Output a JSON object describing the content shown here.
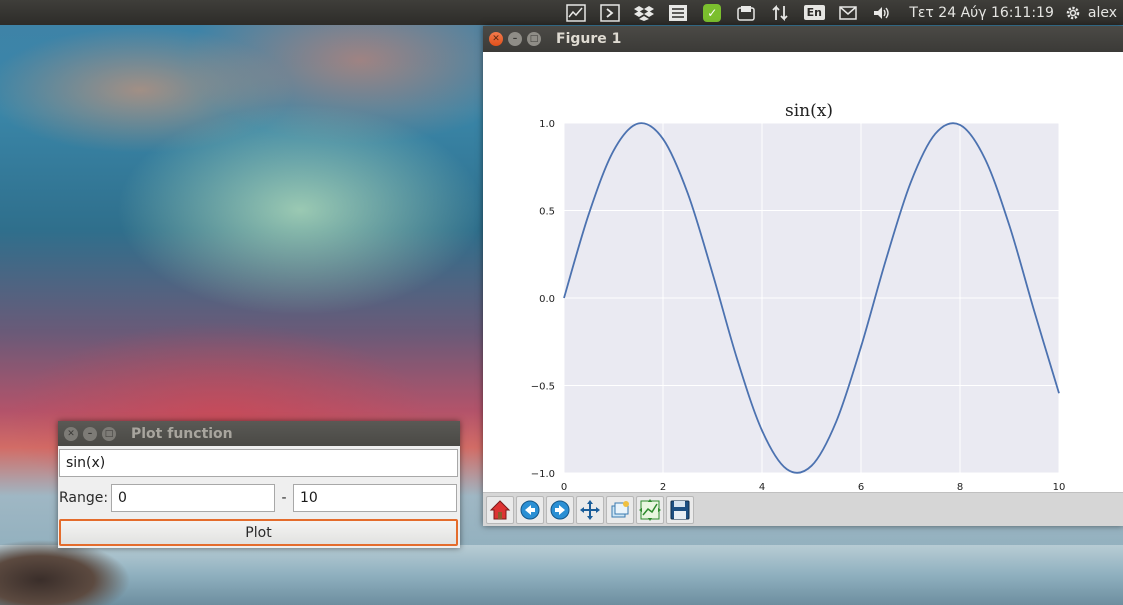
{
  "top_panel": {
    "language": "En",
    "datetime": "Τετ 24 Αύγ 16:11:19",
    "user": "alex"
  },
  "figure_window": {
    "title": "Figure 1"
  },
  "chart_data": {
    "type": "line",
    "title": "sin(x)",
    "xlim": [
      0,
      10
    ],
    "ylim": [
      -1.0,
      1.0
    ],
    "x_ticks": [
      "0",
      "2",
      "4",
      "6",
      "8",
      "10"
    ],
    "y_ticks": [
      "1.0",
      "0.5",
      "0.0",
      "-0.5",
      "-1.0"
    ],
    "grid": true,
    "series": [
      {
        "color": "#4c72b0",
        "x": [
          0,
          0.5,
          1,
          1.5,
          2,
          2.5,
          3,
          3.5,
          4,
          4.5,
          5,
          5.5,
          6,
          6.5,
          7,
          7.5,
          8,
          8.5,
          9,
          9.5,
          10
        ],
        "y": [
          0.0,
          0.479,
          0.841,
          0.997,
          0.909,
          0.598,
          0.141,
          -0.351,
          -0.757,
          -0.978,
          -0.959,
          -0.706,
          -0.279,
          0.215,
          0.657,
          0.938,
          0.989,
          0.798,
          0.412,
          -0.075,
          -0.544
        ]
      }
    ]
  },
  "plot_window": {
    "title": "Plot function",
    "function_value": "sin(x)",
    "range_label": "Range:",
    "range_from": "0",
    "range_separator": "-",
    "range_to": "10",
    "plot_button": "Plot"
  }
}
